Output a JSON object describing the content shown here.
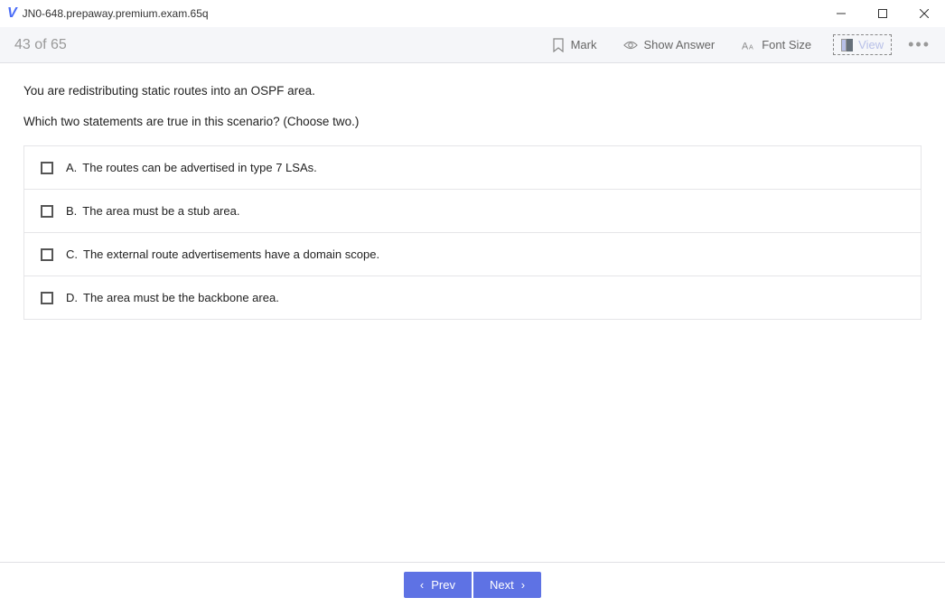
{
  "window": {
    "title": "JN0-648.prepaway.premium.exam.65q"
  },
  "toolbar": {
    "counter": "43 of 65",
    "mark_label": "Mark",
    "show_answer_label": "Show Answer",
    "font_size_label": "Font Size",
    "view_label": "View"
  },
  "question": {
    "line1": "You are redistributing static routes into an OSPF area.",
    "line2": "Which two statements are true in this scenario? (Choose two.)"
  },
  "answers": [
    {
      "letter": "A.",
      "text": "The routes can be advertised in type 7 LSAs."
    },
    {
      "letter": "B.",
      "text": "The area must be a stub area."
    },
    {
      "letter": "C.",
      "text": "The external route advertisements have a domain scope."
    },
    {
      "letter": "D.",
      "text": "The area must be the backbone area."
    }
  ],
  "footer": {
    "prev_label": "Prev",
    "next_label": "Next"
  }
}
